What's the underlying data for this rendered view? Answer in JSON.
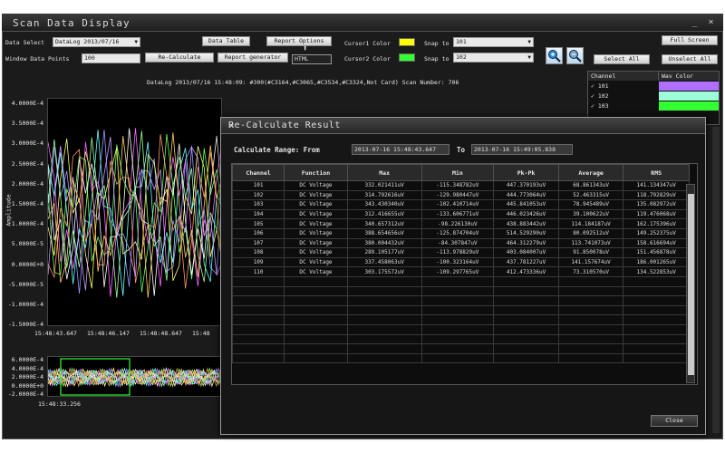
{
  "window": {
    "title": "Scan Data Display",
    "minimize": "_",
    "close": "×"
  },
  "toolbar": {
    "data_select_label": "Data Select",
    "data_select_value": "DataLog 2013/07/16",
    "window_points_label": "Window Data Points",
    "window_points_value": "100",
    "data_table": "Data Table",
    "report_options": "Report Options",
    "recalculate": "Re-Calculate",
    "report_generator": "Report generator",
    "report_format": "HTML",
    "cursor1_label": "Cursor1 Color",
    "cursor2_label": "Cursor2 Color",
    "cursor1_color": "#ffff00",
    "cursor2_color": "#33ff33",
    "snap1_label": "Snap to",
    "snap1_value": "101",
    "snap2_label": "Snap to",
    "snap2_value": "102",
    "zoom_in_icon": "zoom-in-icon",
    "zoom_out_icon": "zoom-out-icon",
    "full_screen": "Full Screen",
    "select_all": "Select All",
    "unselect_all": "Unselect All"
  },
  "chart": {
    "header": "DataLog 2013/07/16 15:48:09: #300(#C3164,#C3065,#C3534,#C3324,Not Card) Scan Number: 706",
    "ylabel": "Amplitude",
    "yticks": [
      "4.0000E-4",
      "3.5000E-4",
      "3.0000E-4",
      "2.5000E-4",
      "2.0000E-4",
      "1.5000E-4",
      "1.0000E-4",
      "5.0000E-5",
      "0.0000E+0",
      "-5.0000E-5",
      "-1.0000E-4",
      "-1.5000E-4"
    ],
    "xticks": [
      "15:48:43.647",
      "15:48:46.147",
      "15:48:48.647",
      "15:48"
    ],
    "overview_yticks": [
      "6.0000E-4",
      "4.0000E-4",
      "2.0000E-4",
      "0.0000E+0",
      "-2.0000E-4"
    ],
    "overview_xtick": "15:48:33.256",
    "series_colors": [
      "#9999ff",
      "#ff66ff",
      "#66ff66",
      "#ffff66",
      "#66ffff",
      "#ffffff",
      "#ff9966",
      "#cc99ff",
      "#99ff99",
      "#ffcc66"
    ]
  },
  "channel_panel": {
    "headers": [
      "Channel",
      "Wav Color"
    ],
    "rows": [
      {
        "label": "101",
        "color": "#b070ff"
      },
      {
        "label": "102",
        "color": "#9dffd8"
      },
      {
        "label": "103",
        "color": "#33ff33"
      }
    ]
  },
  "dialog": {
    "title": "Re-Calculate Result",
    "close_icon": "×",
    "range_label": "Calculate Range: From",
    "range_from": "2013-07-16 15:48:43.647",
    "range_to_label": "To",
    "range_to": "2013-07-16 15:49:05.838",
    "columns": [
      "Channel",
      "Function",
      "Max",
      "Min",
      "Pk-Pk",
      "Average",
      "RMS"
    ],
    "rows": [
      [
        "101",
        "DC Voltage",
        "332.021411uV",
        "-115.348782uV",
        "447.370193uV",
        "68.861343uV",
        "141.134347uV"
      ],
      [
        "102",
        "DC Voltage",
        "314.792616uV",
        "-129.980447uV",
        "444.773064uV",
        "52.463315uV",
        "118.792829uV"
      ],
      [
        "103",
        "DC Voltage",
        "343.430340uV",
        "-102.410714uV",
        "445.841053uV",
        "78.945489uV",
        "135.082972uV"
      ],
      [
        "104",
        "DC Voltage",
        "312.416655uV",
        "-133.606771uV",
        "446.023426uV",
        "39.100622uV",
        "119.476068uV"
      ],
      [
        "105",
        "DC Voltage",
        "340.657312uV",
        "-98.226130uV",
        "438.883442uV",
        "114.184187uV",
        "162.175396uV"
      ],
      [
        "106",
        "DC Voltage",
        "388.654656uV",
        "-125.874704uV",
        "514.529290uV",
        "80.092512uV",
        "149.252375uV"
      ],
      [
        "107",
        "DC Voltage",
        "380.004432uV",
        "-84.307847uV",
        "464.312279uV",
        "113.741073uV",
        "158.616694uV"
      ],
      [
        "108",
        "DC Voltage",
        "289.105177uV",
        "-113.978829uV",
        "403.084007uV",
        "91.850078uV",
        "151.456878uV"
      ],
      [
        "109",
        "DC Voltage",
        "337.458063uV",
        "-100.323164uV",
        "437.781227uV",
        "141.157674uV",
        "186.001265uV"
      ],
      [
        "110",
        "DC Voltage",
        "303.175572uV",
        "-109.297765uV",
        "412.473336uV",
        "73.310570uV",
        "134.522853uV"
      ]
    ],
    "close_button": "Close"
  }
}
